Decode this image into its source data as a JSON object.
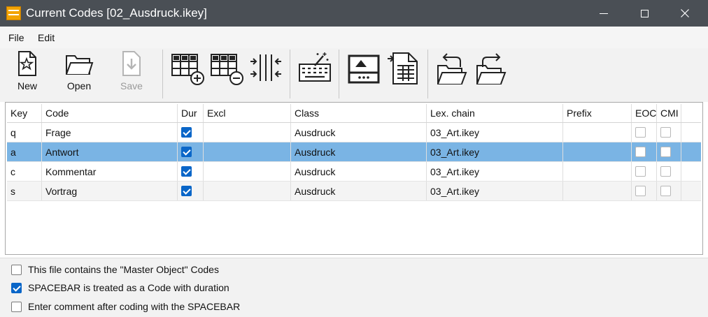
{
  "window": {
    "title": "Current Codes [02_Ausdruck.ikey]",
    "minimize_icon": "minimize-icon",
    "maximize_icon": "maximize-icon",
    "close_icon": "close-icon"
  },
  "menu": {
    "items": [
      "File",
      "Edit"
    ]
  },
  "toolbar": {
    "new_label": "New",
    "open_label": "Open",
    "save_label": "Save",
    "save_enabled": false
  },
  "table": {
    "columns": [
      "Key",
      "Code",
      "Dur",
      "Excl",
      "Class",
      "Lex. chain",
      "Prefix",
      "EOC",
      "CMI"
    ],
    "rows": [
      {
        "key": "q",
        "code": "Frage",
        "dur": true,
        "excl": "",
        "class": "Ausdruck",
        "lex_chain": "03_Art.ikey",
        "prefix": "",
        "eoc": false,
        "cmi": false
      },
      {
        "key": "a",
        "code": "Antwort",
        "dur": true,
        "excl": "",
        "class": "Ausdruck",
        "lex_chain": "03_Art.ikey",
        "prefix": "",
        "eoc": false,
        "cmi": false
      },
      {
        "key": "c",
        "code": "Kommentar",
        "dur": true,
        "excl": "",
        "class": "Ausdruck",
        "lex_chain": "03_Art.ikey",
        "prefix": "",
        "eoc": false,
        "cmi": false
      },
      {
        "key": "s",
        "code": "Vortrag",
        "dur": true,
        "excl": "",
        "class": "Ausdruck",
        "lex_chain": "03_Art.ikey",
        "prefix": "",
        "eoc": false,
        "cmi": false
      }
    ],
    "selected_row": 1
  },
  "options": [
    {
      "label": "This file contains the \"Master Object\" Codes",
      "checked": false
    },
    {
      "label": "SPACEBAR is treated as a Code with duration",
      "checked": true
    },
    {
      "label": "Enter comment after coding with the SPACEBAR",
      "checked": false
    }
  ],
  "colors": {
    "titlebar": "#4a4f55",
    "selection": "#7ab4e4",
    "checkbox_checked": "#0a66c8",
    "app_icon": "#f2a300"
  }
}
